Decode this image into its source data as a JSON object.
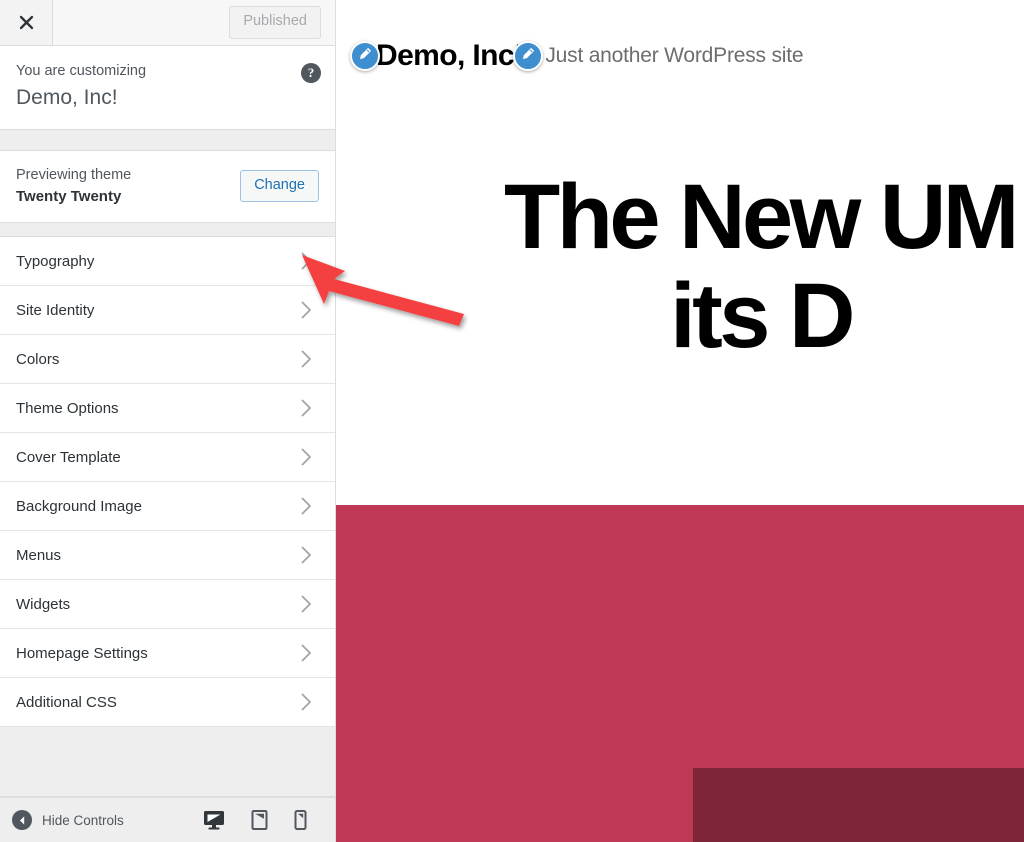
{
  "customizer": {
    "topbar": {
      "close_icon": "close-x-icon",
      "publish_label": "Published"
    },
    "customizing": {
      "eyebrow": "You are customizing",
      "site_name": "Demo, Inc!",
      "help_icon": "help-question-icon",
      "help_glyph": "?"
    },
    "theme": {
      "eyebrow": "Previewing theme",
      "name": "Twenty Twenty",
      "change_label": "Change"
    },
    "panels": [
      {
        "label": "Typography",
        "icon": "chevron-right-icon"
      },
      {
        "label": "Site Identity",
        "icon": "chevron-right-icon"
      },
      {
        "label": "Colors",
        "icon": "chevron-right-icon"
      },
      {
        "label": "Theme Options",
        "icon": "chevron-right-icon"
      },
      {
        "label": "Cover Template",
        "icon": "chevron-right-icon"
      },
      {
        "label": "Background Image",
        "icon": "chevron-right-icon"
      },
      {
        "label": "Menus",
        "icon": "chevron-right-icon"
      },
      {
        "label": "Widgets",
        "icon": "chevron-right-icon"
      },
      {
        "label": "Homepage Settings",
        "icon": "chevron-right-icon"
      },
      {
        "label": "Additional CSS",
        "icon": "chevron-right-icon"
      }
    ],
    "footer": {
      "collapse_label": "Hide Controls",
      "collapse_icon": "collapse-left-arrow-icon",
      "devices": [
        {
          "name": "desktop",
          "icon": "desktop-monitor-icon",
          "active": true
        },
        {
          "name": "tablet",
          "icon": "tablet-icon",
          "active": false
        },
        {
          "name": "mobile",
          "icon": "mobile-phone-icon",
          "active": false
        }
      ]
    }
  },
  "preview": {
    "site_title": "Demo, Inc!",
    "tagline": "Just another WordPress site",
    "edit_pin_icon": "pencil-edit-icon",
    "hero_line1": "The New UM",
    "hero_line2": "its D"
  },
  "annotation": {
    "arrow_icon": "red-pointer-arrow-icon",
    "arrow_color": "#f4413f"
  },
  "colors": {
    "accent_blue": "#2271b1",
    "pin_blue": "#3e8ed0",
    "crimson": "#bf3855",
    "maroon": "#7e2638",
    "sidebar_bg": "#eee",
    "panel_bg": "#ffffff"
  }
}
